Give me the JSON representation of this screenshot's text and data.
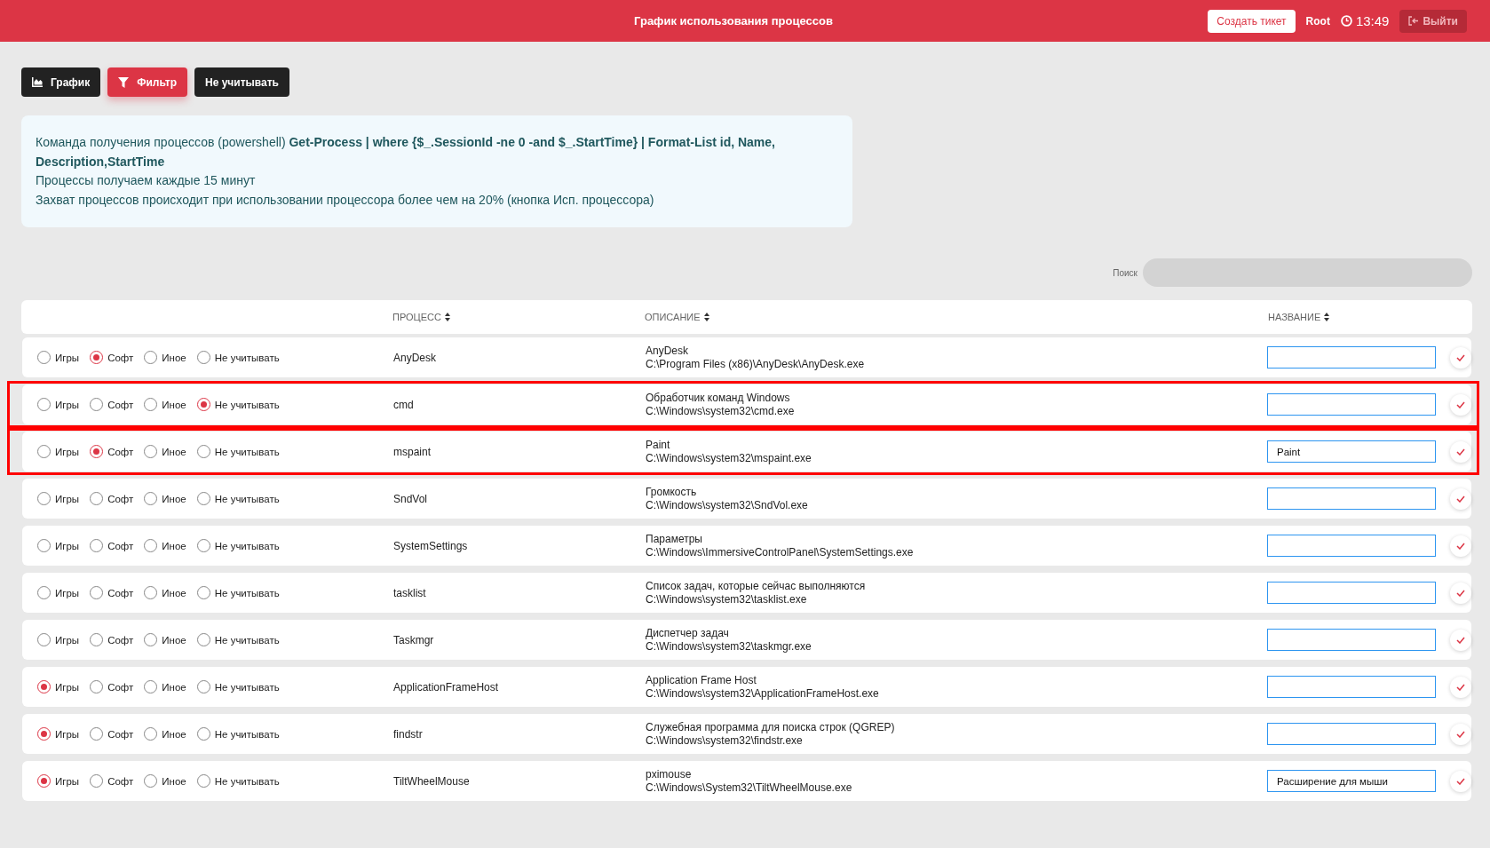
{
  "header": {
    "title": "График использования процессов",
    "ticket_button": "Создать тикет",
    "user": "Root",
    "time": "13:49",
    "logout_button": "Выйти"
  },
  "toolbar": [
    {
      "kind": "chart",
      "label": "График",
      "selected": false
    },
    {
      "kind": "filter",
      "label": "Фильтр",
      "selected": true
    },
    {
      "kind": "plain",
      "label": "Не учитывать",
      "selected": false
    }
  ],
  "info": [
    "Команда получения процессов (powershell) **Get-Process | where {$_.SessionId -ne 0 -and $_.StartTime} | Format-List id, Name, Description,StartTime**",
    "Процессы получаем каждые 15 минут",
    "Захват процессов происходит при использовании процессора более чем на 20% (кнопка Исп. процессора)"
  ],
  "search": {
    "label": "Поиск"
  },
  "table": {
    "columns": [
      "ПРОЦЕСС",
      "ОПИСАНИЕ",
      "НАЗВАНИЕ"
    ],
    "rows": [
      {
        "highlighted": false,
        "process": "AnyDesk",
        "description": "AnyDesk",
        "path": "C:\\Program Files (x86)\\AnyDesk\\AnyDesk.exe",
        "name": "",
        "options": [
          {
            "label": "Игры",
            "selected": false
          },
          {
            "label": "Софт",
            "selected": true
          },
          {
            "label": "Иное",
            "selected": false
          },
          {
            "label": "Не учитывать",
            "selected": false
          }
        ]
      },
      {
        "highlighted": true,
        "process": "cmd",
        "description": "Обработчик команд Windows",
        "path": "C:\\Windows\\system32\\cmd.exe",
        "name": "",
        "options": [
          {
            "label": "Игры",
            "selected": false
          },
          {
            "label": "Софт",
            "selected": false
          },
          {
            "label": "Иное",
            "selected": false
          },
          {
            "label": "Не учитывать",
            "selected": true
          }
        ]
      },
      {
        "highlighted": true,
        "process": "mspaint",
        "description": "Paint",
        "path": "C:\\Windows\\system32\\mspaint.exe",
        "name": "Paint",
        "options": [
          {
            "label": "Игры",
            "selected": false
          },
          {
            "label": "Софт",
            "selected": true
          },
          {
            "label": "Иное",
            "selected": false
          },
          {
            "label": "Не учитывать",
            "selected": false
          }
        ]
      },
      {
        "highlighted": false,
        "process": "SndVol",
        "description": "Громкость",
        "path": "C:\\Windows\\system32\\SndVol.exe",
        "name": "",
        "options": [
          {
            "label": "Игры",
            "selected": false
          },
          {
            "label": "Софт",
            "selected": false
          },
          {
            "label": "Иное",
            "selected": false
          },
          {
            "label": "Не учитывать",
            "selected": false
          }
        ]
      },
      {
        "highlighted": false,
        "process": "SystemSettings",
        "description": "Параметры",
        "path": "C:\\Windows\\ImmersiveControlPanel\\SystemSettings.exe",
        "name": "",
        "options": [
          {
            "label": "Игры",
            "selected": false
          },
          {
            "label": "Софт",
            "selected": false
          },
          {
            "label": "Иное",
            "selected": false
          },
          {
            "label": "Не учитывать",
            "selected": false
          }
        ]
      },
      {
        "highlighted": false,
        "process": "tasklist",
        "description": "Список задач, которые сейчас выполняются",
        "path": "C:\\Windows\\system32\\tasklist.exe",
        "name": "",
        "options": [
          {
            "label": "Игры",
            "selected": false
          },
          {
            "label": "Софт",
            "selected": false
          },
          {
            "label": "Иное",
            "selected": false
          },
          {
            "label": "Не учитывать",
            "selected": false
          }
        ]
      },
      {
        "highlighted": false,
        "process": "Taskmgr",
        "description": "Диспетчер задач",
        "path": "C:\\Windows\\system32\\taskmgr.exe",
        "name": "",
        "options": [
          {
            "label": "Игры",
            "selected": false
          },
          {
            "label": "Софт",
            "selected": false
          },
          {
            "label": "Иное",
            "selected": false
          },
          {
            "label": "Не учитывать",
            "selected": false
          }
        ]
      },
      {
        "highlighted": false,
        "process": "ApplicationFrameHost",
        "description": "Application Frame Host",
        "path": "C:\\Windows\\system32\\ApplicationFrameHost.exe",
        "name": "",
        "options": [
          {
            "label": "Игры",
            "selected": true
          },
          {
            "label": "Софт",
            "selected": false
          },
          {
            "label": "Иное",
            "selected": false
          },
          {
            "label": "Не учитывать",
            "selected": false
          }
        ]
      },
      {
        "highlighted": false,
        "process": "findstr",
        "description": "Служебная программа для поиска строк (QGREP)",
        "path": "C:\\Windows\\system32\\findstr.exe",
        "name": "",
        "options": [
          {
            "label": "Игры",
            "selected": true
          },
          {
            "label": "Софт",
            "selected": false
          },
          {
            "label": "Иное",
            "selected": false
          },
          {
            "label": "Не учитывать",
            "selected": false
          }
        ]
      },
      {
        "highlighted": false,
        "process": "TiltWheelMouse",
        "description": "pximouse",
        "path": "C:\\Windows\\System32\\TiltWheelMouse.exe",
        "name": "Расширение для мыши",
        "options": [
          {
            "label": "Игры",
            "selected": true
          },
          {
            "label": "Софт",
            "selected": false
          },
          {
            "label": "Иное",
            "selected": false
          },
          {
            "label": "Не учитывать",
            "selected": false
          }
        ]
      }
    ]
  }
}
